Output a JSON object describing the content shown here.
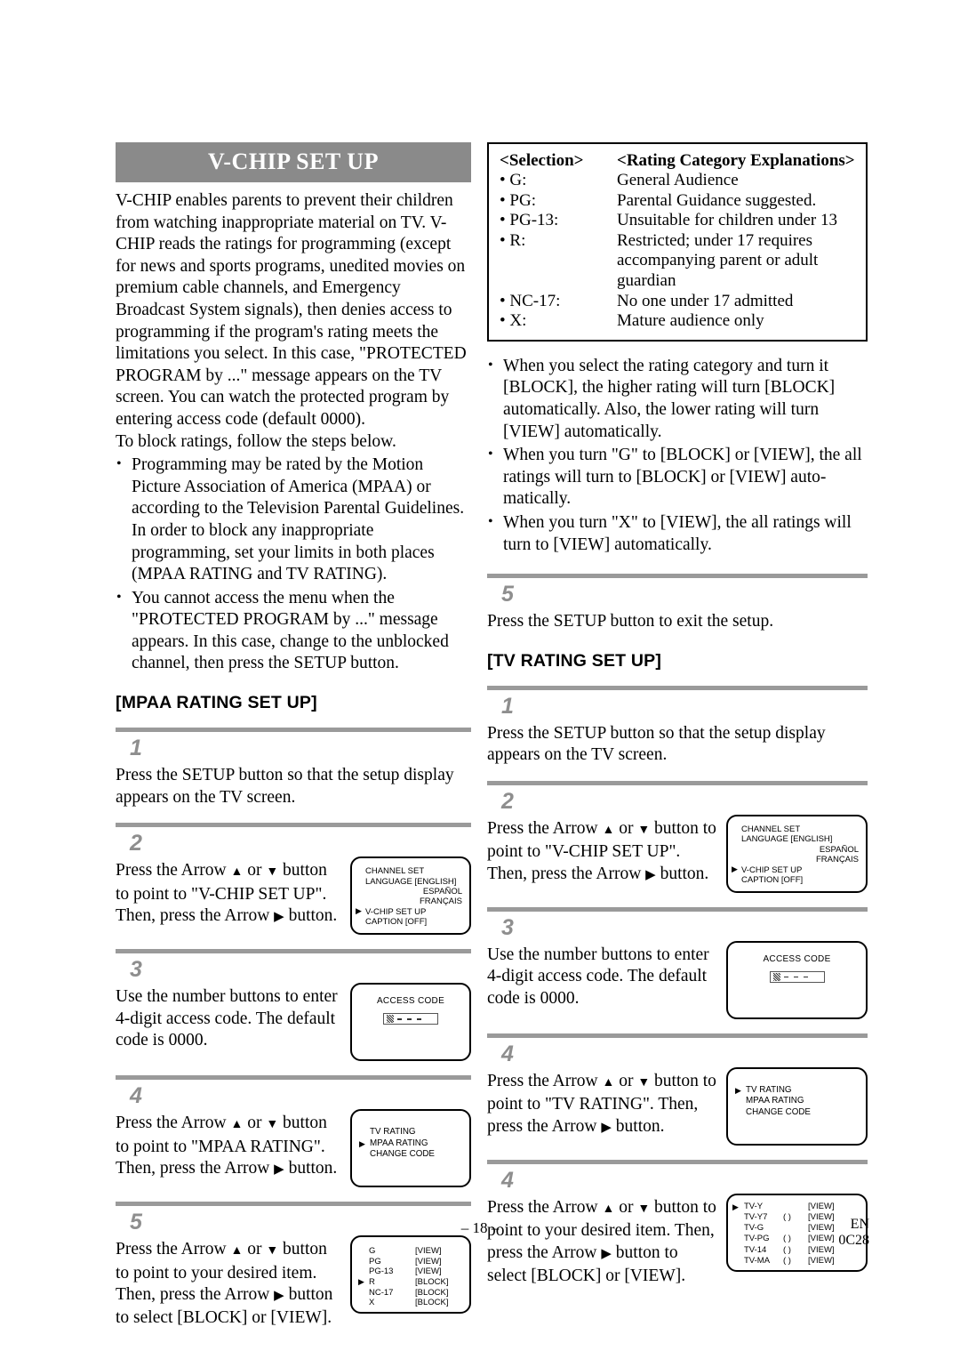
{
  "document": {
    "title": "V-CHIP SET UP",
    "footer_page": "– 18 –",
    "footer_lang": "EN",
    "footer_code": "0C28"
  },
  "intro": {
    "paragraph": "V-CHIP enables parents to prevent their children from watching inappropriate material on TV. V-CHIP reads the ratings for programming (except for news and sports programs, unedited movies on premium cable channels, and Emergency Broadcast System signals), then denies access to programming if the program's rating meets the limitations you select. In this case, \"PROTECTED PROGRAM by ...\" message appears on the TV screen. You can watch the protected program by entering access code (default 0000).",
    "steps_lead": "To block ratings, follow the steps below.",
    "bullets": [
      "Programming may be rated by the Motion Picture Association of America (MPAA) or according to the Television Parental Guidelines. In order to block any inappropriate programming, set your limits in both places (MPAA RATING and TV RATING).",
      "You cannot access the menu when the \"PROTECTED PROGRAM by ...\" message appears. In this case, change to the unblocked channel, then press the SETUP button."
    ]
  },
  "rating_table": {
    "header_selection": "<Selection>",
    "header_explanation": "<Rating Category Explanations>",
    "rows": [
      {
        "selection": "• G:",
        "explanation": "General Audience",
        "continued": []
      },
      {
        "selection": "• PG:",
        "explanation": "Parental Guidance suggested.",
        "continued": []
      },
      {
        "selection": "• PG-13:",
        "explanation": "Unsuitable for children under 13",
        "continued": []
      },
      {
        "selection": "• R:",
        "explanation": "Restricted; under 17 requires",
        "continued": [
          "accompanying parent or adult",
          "guardian"
        ]
      },
      {
        "selection": "• NC-17:",
        "explanation": "No one under 17 admitted",
        "continued": []
      },
      {
        "selection": "• X:",
        "explanation": "Mature audience only",
        "continued": []
      }
    ]
  },
  "rating_notes": [
    "When you select the rating category and turn it [BLOCK], the higher rating will turn [BLOCK] automatically. Also, the lower rating will turn [VIEW] automatically.",
    "When you turn \"G\" to [BLOCK] or [VIEW], the all ratings will turn to [BLOCK] or [VIEW] auto-matically.",
    "When you turn \"X\" to [VIEW], the all ratings will turn to [VIEW] automatically."
  ],
  "mpaa_section": {
    "heading": "[MPAA RATING SET UP]",
    "steps": [
      {
        "num": "1",
        "text_parts": [
          "Press the SETUP button so that the setup display appears on the TV screen."
        ]
      },
      {
        "num": "2",
        "text_parts": [
          "Press the Arrow ",
          " or ",
          " button to point to \"V-CHIP SET UP\". Then, press the Arrow ",
          " button."
        ]
      },
      {
        "num": "3",
        "text_parts": [
          "Use the number buttons to enter 4-digit access code. The default code is 0000."
        ]
      },
      {
        "num": "4",
        "text_parts": [
          "Press the Arrow ",
          " or ",
          " button to point to \"MPAA RATING\". Then, press the Arrow ",
          " button."
        ]
      },
      {
        "num": "5",
        "text_parts": [
          "Press the Arrow ",
          " or ",
          " button to point to your desired item. Then, press the Arrow ",
          " button to select [BLOCK] or [VIEW]."
        ]
      }
    ]
  },
  "tv_section": {
    "exit_step_num": "5",
    "exit_step_text": "Press the SETUP button to exit the setup.",
    "heading": "[TV RATING SET UP]",
    "steps": [
      {
        "num": "1",
        "text_parts": [
          "Press the SETUP button so that the setup display appears on the TV screen."
        ]
      },
      {
        "num": "2",
        "text_parts": [
          "Press the Arrow ",
          " or ",
          " button to point to \"V-CHIP SET UP\". Then, press the Arrow ",
          " button."
        ]
      },
      {
        "num": "3",
        "text_parts": [
          "Use the number buttons to enter 4-digit access code. The default code is 0000."
        ]
      },
      {
        "num": "4",
        "text_parts": [
          "Press the Arrow ",
          " or ",
          " button to point to \"TV RATING\". Then, press the Arrow ",
          " button."
        ]
      },
      {
        "num": "4",
        "text_parts": [
          "Press the Arrow ",
          " or ",
          " button to point to your desired item. Then, press the Arrow ",
          " button to select [BLOCK] or [VIEW]."
        ]
      }
    ]
  },
  "osd": {
    "setup_menu": {
      "line1": "CHANNEL SET",
      "line2": "LANGUAGE [ENGLISH]",
      "line3": "ESPAÑOL",
      "line4": "FRANÇAIS",
      "line5": "V-CHIP SET UP",
      "line6": "CAPTION [OFF]"
    },
    "access_code": {
      "title": "ACCESS CODE"
    },
    "rating_menu_mpaa": {
      "item1": "TV RATING",
      "item2": "MPAA RATING",
      "item3": "CHANGE CODE"
    },
    "rating_menu_tv": {
      "item1": "TV RATING",
      "item2": "MPAA RATING",
      "item3": "CHANGE CODE"
    },
    "mpaa_ratings": [
      {
        "label": "G",
        "value": "[VIEW]",
        "selected": false
      },
      {
        "label": "PG",
        "value": "[VIEW]",
        "selected": false
      },
      {
        "label": "PG-13",
        "value": "[VIEW]",
        "selected": false
      },
      {
        "label": "R",
        "value": "[BLOCK]",
        "selected": true
      },
      {
        "label": "NC-17",
        "value": "[BLOCK]",
        "selected": false
      },
      {
        "label": "X",
        "value": "[BLOCK]",
        "selected": false
      }
    ],
    "tv_ratings": [
      {
        "label": "TV-Y",
        "paren": "",
        "value": "[VIEW]",
        "selected": true
      },
      {
        "label": "TV-Y7",
        "paren": "(  )",
        "value": "[VIEW]",
        "selected": false
      },
      {
        "label": "TV-G",
        "paren": "",
        "value": "[VIEW]",
        "selected": false
      },
      {
        "label": "TV-PG",
        "paren": "(  )",
        "value": "[VIEW]",
        "selected": false
      },
      {
        "label": "TV-14",
        "paren": "(  )",
        "value": "[VIEW]",
        "selected": false
      },
      {
        "label": "TV-MA",
        "paren": "(  )",
        "value": "[VIEW]",
        "selected": false
      }
    ]
  }
}
